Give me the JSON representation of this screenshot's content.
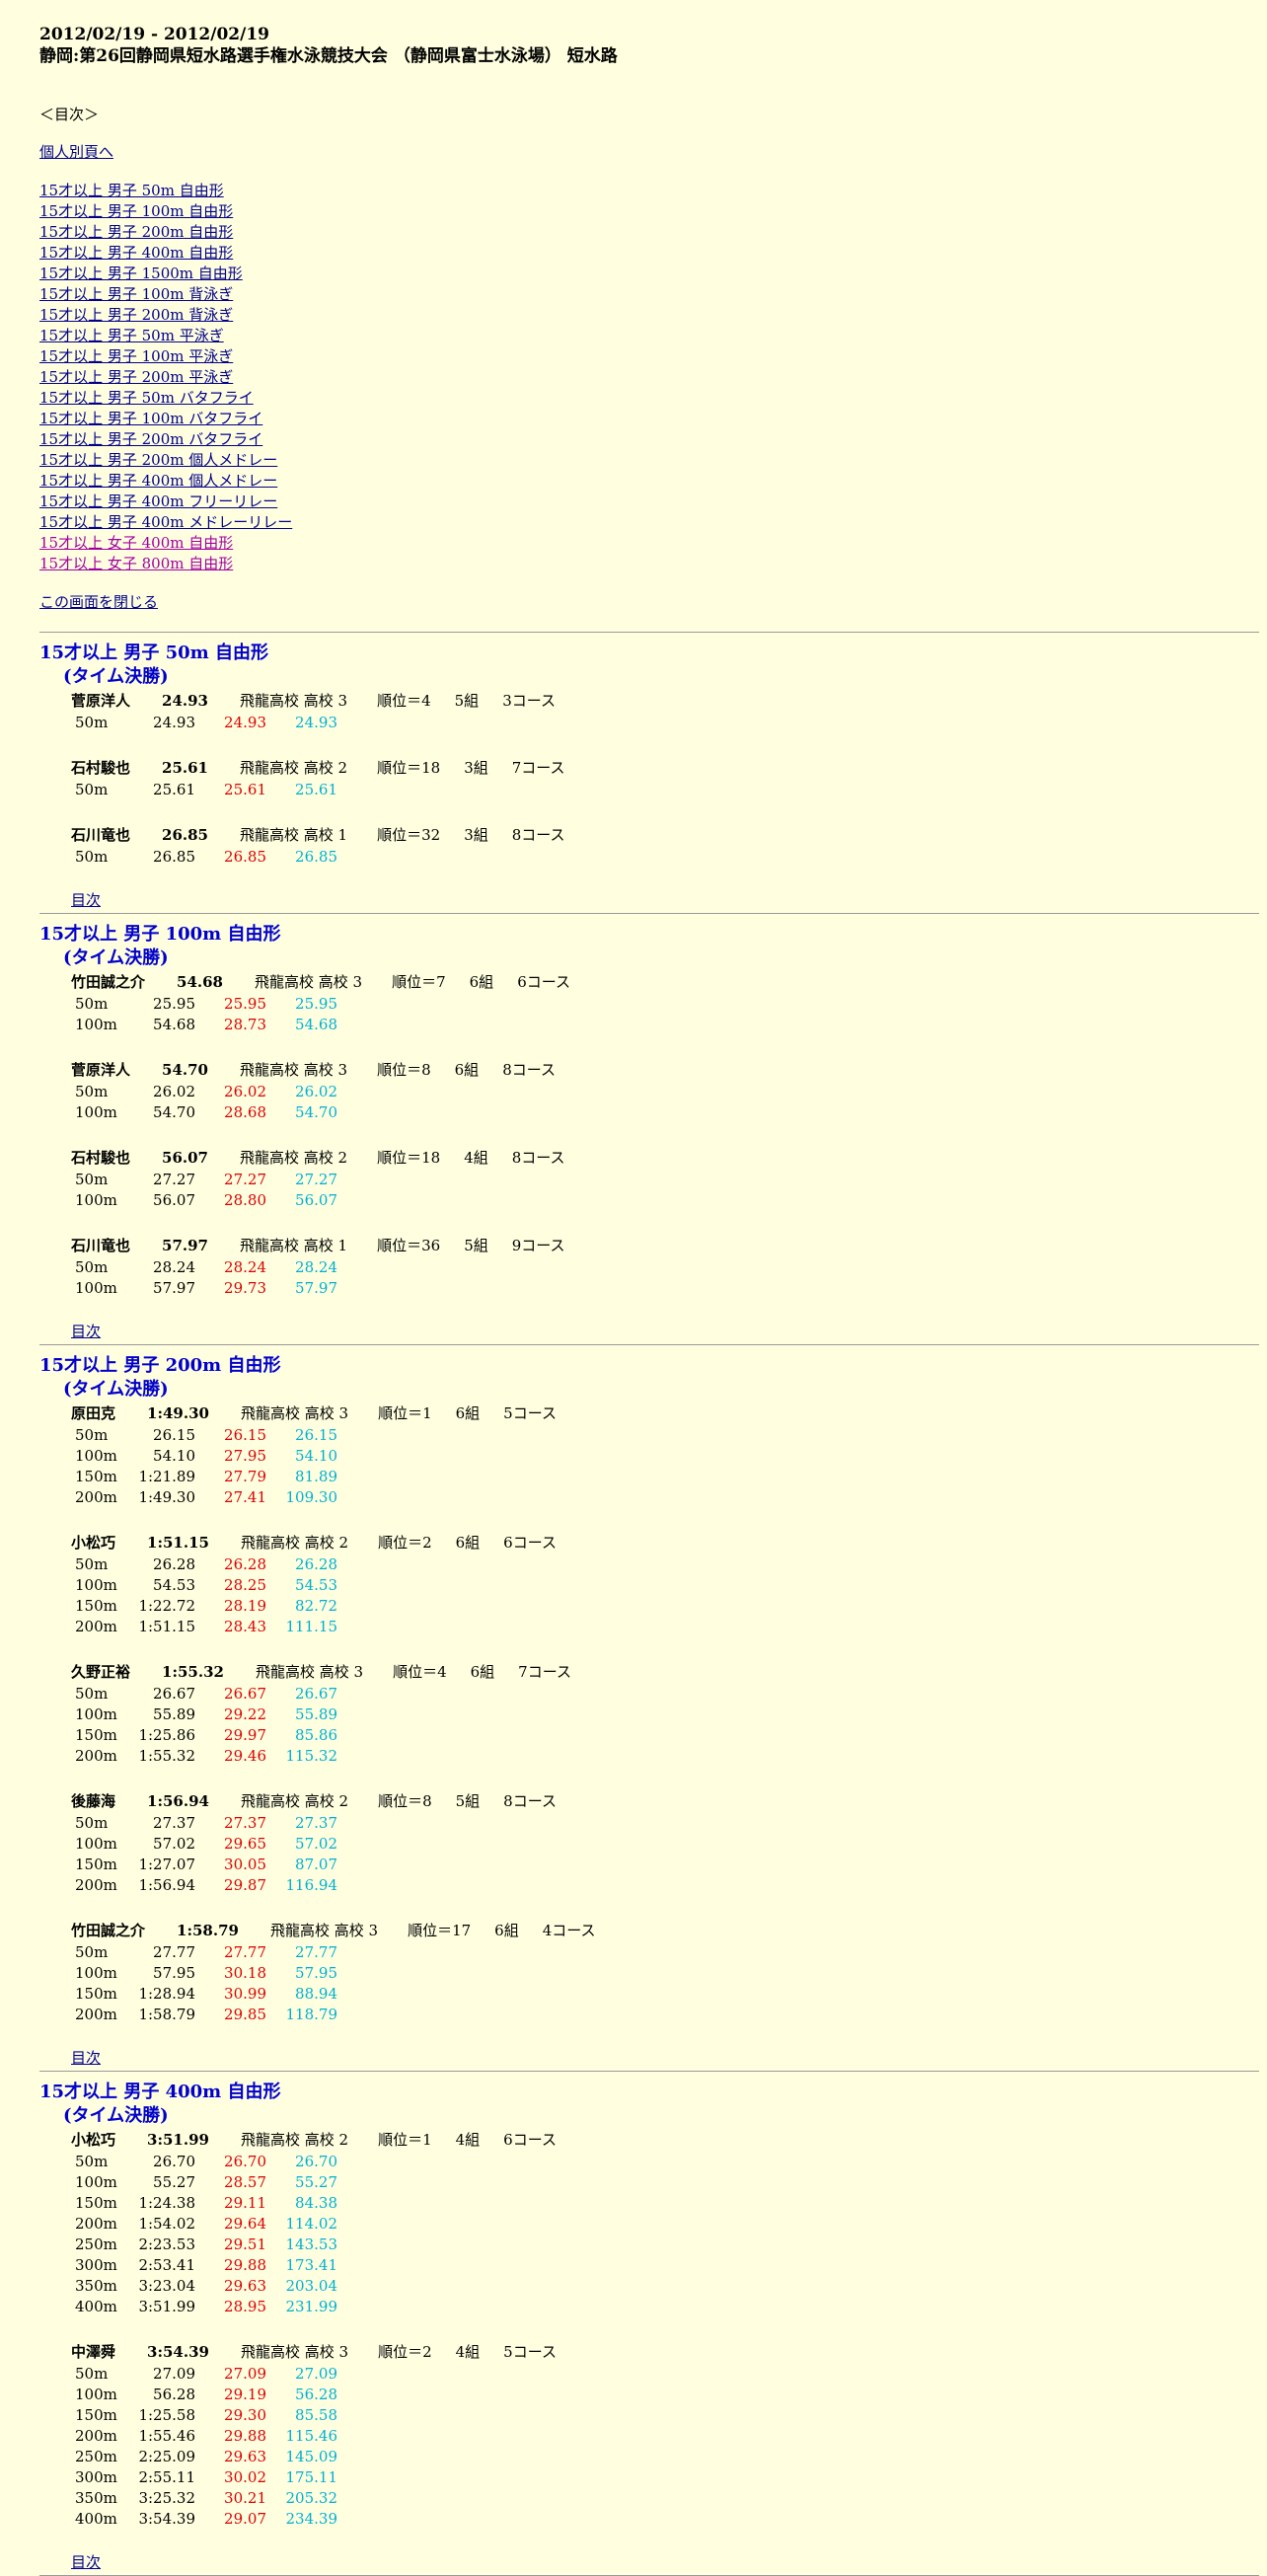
{
  "header": {
    "date": "2012/02/19 - 2012/02/19",
    "title": "静岡:第26回静岡県短水路選手権水泳競技大会 （静岡県富士水泳場） 短水路"
  },
  "toc": {
    "heading": "＜目次＞",
    "individual_link": "個人別頁へ",
    "items": [
      {
        "label": "15才以上 男子 50m 自由形",
        "female": false
      },
      {
        "label": "15才以上 男子 100m 自由形",
        "female": false
      },
      {
        "label": "15才以上 男子 200m 自由形",
        "female": false
      },
      {
        "label": "15才以上 男子 400m 自由形",
        "female": false
      },
      {
        "label": "15才以上 男子 1500m 自由形",
        "female": false
      },
      {
        "label": "15才以上 男子 100m 背泳ぎ",
        "female": false
      },
      {
        "label": "15才以上 男子 200m 背泳ぎ",
        "female": false
      },
      {
        "label": "15才以上 男子 50m 平泳ぎ",
        "female": false
      },
      {
        "label": "15才以上 男子 100m 平泳ぎ",
        "female": false
      },
      {
        "label": "15才以上 男子 200m 平泳ぎ",
        "female": false
      },
      {
        "label": "15才以上 男子 50m バタフライ",
        "female": false
      },
      {
        "label": "15才以上 男子 100m バタフライ",
        "female": false
      },
      {
        "label": "15才以上 男子 200m バタフライ",
        "female": false
      },
      {
        "label": "15才以上 男子 200m 個人メドレー",
        "female": false
      },
      {
        "label": "15才以上 男子 400m 個人メドレー",
        "female": false
      },
      {
        "label": "15才以上 男子 400m フリーリレー",
        "female": false
      },
      {
        "label": "15才以上 男子 400m メドレーリレー",
        "female": false
      },
      {
        "label": "15才以上 女子 400m 自由形",
        "female": true
      },
      {
        "label": "15才以上 女子 800m 自由形",
        "female": true
      }
    ],
    "close_link": "この画面を閉じる"
  },
  "back_label": "目次",
  "events": [
    {
      "title": "15才以上 男子 50m 自由形",
      "subtitle": "(タイム決勝)",
      "swimmers": [
        {
          "name": "菅原洋人",
          "time": "24.93",
          "school": "飛龍高校 高校 3",
          "rank": "順位＝4",
          "heat": "5組",
          "lane": "3コース",
          "splits": [
            {
              "d": "50m",
              "c": "24.93",
              "l": "24.93",
              "t": "24.93"
            }
          ]
        },
        {
          "name": "石村駿也",
          "time": "25.61",
          "school": "飛龍高校 高校 2",
          "rank": "順位＝18",
          "heat": "3組",
          "lane": "7コース",
          "splits": [
            {
              "d": "50m",
              "c": "25.61",
              "l": "25.61",
              "t": "25.61"
            }
          ]
        },
        {
          "name": "石川竜也",
          "time": "26.85",
          "school": "飛龍高校 高校 1",
          "rank": "順位＝32",
          "heat": "3組",
          "lane": "8コース",
          "splits": [
            {
              "d": "50m",
              "c": "26.85",
              "l": "26.85",
              "t": "26.85"
            }
          ]
        }
      ]
    },
    {
      "title": "15才以上 男子 100m 自由形",
      "subtitle": "(タイム決勝)",
      "swimmers": [
        {
          "name": "竹田誠之介",
          "time": "54.68",
          "school": "飛龍高校 高校 3",
          "rank": "順位＝7",
          "heat": "6組",
          "lane": "6コース",
          "splits": [
            {
              "d": "50m",
              "c": "25.95",
              "l": "25.95",
              "t": "25.95"
            },
            {
              "d": "100m",
              "c": "54.68",
              "l": "28.73",
              "t": "54.68"
            }
          ]
        },
        {
          "name": "菅原洋人",
          "time": "54.70",
          "school": "飛龍高校 高校 3",
          "rank": "順位＝8",
          "heat": "6組",
          "lane": "8コース",
          "splits": [
            {
              "d": "50m",
              "c": "26.02",
              "l": "26.02",
              "t": "26.02"
            },
            {
              "d": "100m",
              "c": "54.70",
              "l": "28.68",
              "t": "54.70"
            }
          ]
        },
        {
          "name": "石村駿也",
          "time": "56.07",
          "school": "飛龍高校 高校 2",
          "rank": "順位＝18",
          "heat": "4組",
          "lane": "8コース",
          "splits": [
            {
              "d": "50m",
              "c": "27.27",
              "l": "27.27",
              "t": "27.27"
            },
            {
              "d": "100m",
              "c": "56.07",
              "l": "28.80",
              "t": "56.07"
            }
          ]
        },
        {
          "name": "石川竜也",
          "time": "57.97",
          "school": "飛龍高校 高校 1",
          "rank": "順位＝36",
          "heat": "5組",
          "lane": "9コース",
          "splits": [
            {
              "d": "50m",
              "c": "28.24",
              "l": "28.24",
              "t": "28.24"
            },
            {
              "d": "100m",
              "c": "57.97",
              "l": "29.73",
              "t": "57.97"
            }
          ]
        }
      ]
    },
    {
      "title": "15才以上 男子 200m 自由形",
      "subtitle": "(タイム決勝)",
      "swimmers": [
        {
          "name": "原田克",
          "time": "1:49.30",
          "school": "飛龍高校 高校 3",
          "rank": "順位＝1",
          "heat": "6組",
          "lane": "5コース",
          "splits": [
            {
              "d": "50m",
              "c": "26.15",
              "l": "26.15",
              "t": "26.15"
            },
            {
              "d": "100m",
              "c": "54.10",
              "l": "27.95",
              "t": "54.10"
            },
            {
              "d": "150m",
              "c": "1:21.89",
              "l": "27.79",
              "t": "81.89"
            },
            {
              "d": "200m",
              "c": "1:49.30",
              "l": "27.41",
              "t": "109.30"
            }
          ]
        },
        {
          "name": "小松巧",
          "time": "1:51.15",
          "school": "飛龍高校 高校 2",
          "rank": "順位＝2",
          "heat": "6組",
          "lane": "6コース",
          "splits": [
            {
              "d": "50m",
              "c": "26.28",
              "l": "26.28",
              "t": "26.28"
            },
            {
              "d": "100m",
              "c": "54.53",
              "l": "28.25",
              "t": "54.53"
            },
            {
              "d": "150m",
              "c": "1:22.72",
              "l": "28.19",
              "t": "82.72"
            },
            {
              "d": "200m",
              "c": "1:51.15",
              "l": "28.43",
              "t": "111.15"
            }
          ]
        },
        {
          "name": "久野正裕",
          "time": "1:55.32",
          "school": "飛龍高校 高校 3",
          "rank": "順位＝4",
          "heat": "6組",
          "lane": "7コース",
          "splits": [
            {
              "d": "50m",
              "c": "26.67",
              "l": "26.67",
              "t": "26.67"
            },
            {
              "d": "100m",
              "c": "55.89",
              "l": "29.22",
              "t": "55.89"
            },
            {
              "d": "150m",
              "c": "1:25.86",
              "l": "29.97",
              "t": "85.86"
            },
            {
              "d": "200m",
              "c": "1:55.32",
              "l": "29.46",
              "t": "115.32"
            }
          ]
        },
        {
          "name": "後藤海",
          "time": "1:56.94",
          "school": "飛龍高校 高校 2",
          "rank": "順位＝8",
          "heat": "5組",
          "lane": "8コース",
          "splits": [
            {
              "d": "50m",
              "c": "27.37",
              "l": "27.37",
              "t": "27.37"
            },
            {
              "d": "100m",
              "c": "57.02",
              "l": "29.65",
              "t": "57.02"
            },
            {
              "d": "150m",
              "c": "1:27.07",
              "l": "30.05",
              "t": "87.07"
            },
            {
              "d": "200m",
              "c": "1:56.94",
              "l": "29.87",
              "t": "116.94"
            }
          ]
        },
        {
          "name": "竹田誠之介",
          "time": "1:58.79",
          "school": "飛龍高校 高校 3",
          "rank": "順位＝17",
          "heat": "6組",
          "lane": "4コース",
          "splits": [
            {
              "d": "50m",
              "c": "27.77",
              "l": "27.77",
              "t": "27.77"
            },
            {
              "d": "100m",
              "c": "57.95",
              "l": "30.18",
              "t": "57.95"
            },
            {
              "d": "150m",
              "c": "1:28.94",
              "l": "30.99",
              "t": "88.94"
            },
            {
              "d": "200m",
              "c": "1:58.79",
              "l": "29.85",
              "t": "118.79"
            }
          ]
        }
      ]
    },
    {
      "title": "15才以上 男子 400m 自由形",
      "subtitle": "(タイム決勝)",
      "swimmers": [
        {
          "name": "小松巧",
          "time": "3:51.99",
          "school": "飛龍高校 高校 2",
          "rank": "順位＝1",
          "heat": "4組",
          "lane": "6コース",
          "splits": [
            {
              "d": "50m",
              "c": "26.70",
              "l": "26.70",
              "t": "26.70"
            },
            {
              "d": "100m",
              "c": "55.27",
              "l": "28.57",
              "t": "55.27"
            },
            {
              "d": "150m",
              "c": "1:24.38",
              "l": "29.11",
              "t": "84.38"
            },
            {
              "d": "200m",
              "c": "1:54.02",
              "l": "29.64",
              "t": "114.02"
            },
            {
              "d": "250m",
              "c": "2:23.53",
              "l": "29.51",
              "t": "143.53"
            },
            {
              "d": "300m",
              "c": "2:53.41",
              "l": "29.88",
              "t": "173.41"
            },
            {
              "d": "350m",
              "c": "3:23.04",
              "l": "29.63",
              "t": "203.04"
            },
            {
              "d": "400m",
              "c": "3:51.99",
              "l": "28.95",
              "t": "231.99"
            }
          ]
        },
        {
          "name": "中澤舜",
          "time": "3:54.39",
          "school": "飛龍高校 高校 3",
          "rank": "順位＝2",
          "heat": "4組",
          "lane": "5コース",
          "splits": [
            {
              "d": "50m",
              "c": "27.09",
              "l": "27.09",
              "t": "27.09"
            },
            {
              "d": "100m",
              "c": "56.28",
              "l": "29.19",
              "t": "56.28"
            },
            {
              "d": "150m",
              "c": "1:25.58",
              "l": "29.30",
              "t": "85.58"
            },
            {
              "d": "200m",
              "c": "1:55.46",
              "l": "29.88",
              "t": "115.46"
            },
            {
              "d": "250m",
              "c": "2:25.09",
              "l": "29.63",
              "t": "145.09"
            },
            {
              "d": "300m",
              "c": "2:55.11",
              "l": "30.02",
              "t": "175.11"
            },
            {
              "d": "350m",
              "c": "3:25.32",
              "l": "30.21",
              "t": "205.32"
            },
            {
              "d": "400m",
              "c": "3:54.39",
              "l": "29.07",
              "t": "234.39"
            }
          ]
        }
      ]
    }
  ]
}
